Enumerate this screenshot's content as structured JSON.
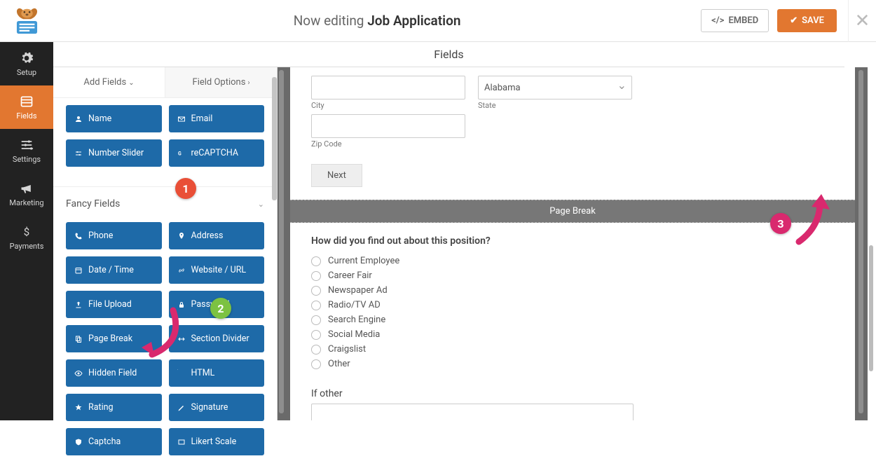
{
  "header": {
    "editing_prefix": "Now editing",
    "form_name": "Job Application",
    "embed": "EMBED",
    "save": "SAVE"
  },
  "leftnav": {
    "setup": "Setup",
    "fields": "Fields",
    "settings": "Settings",
    "marketing": "Marketing",
    "payments": "Payments"
  },
  "fields_header": "Fields",
  "sidetabs": {
    "add_fields": "Add Fields",
    "field_options": "Field Options"
  },
  "standard_fields": {
    "name": "Name",
    "email": "Email",
    "number_slider": "Number Slider",
    "recaptcha": "reCAPTCHA"
  },
  "fancy_section": "Fancy Fields",
  "fancy_fields": {
    "phone": "Phone",
    "address": "Address",
    "datetime": "Date / Time",
    "website": "Website / URL",
    "fileupload": "File Upload",
    "password": "Password",
    "pagebreak": "Page Break",
    "sectiondivider": "Section Divider",
    "hiddenfield": "Hidden Field",
    "html": "HTML",
    "rating": "Rating",
    "signature": "Signature",
    "captcha": "Captcha",
    "likert": "Likert Scale"
  },
  "preview": {
    "state_value": "Alabama",
    "city_label": "City",
    "state_label": "State",
    "zip_label": "Zip Code",
    "next": "Next",
    "pagebreak": "Page Break",
    "question": "How did you find out about this position?",
    "options": {
      "o1": "Current Employee",
      "o2": "Career Fair",
      "o3": "Newspaper Ad",
      "o4": "Radio/TV AD",
      "o5": "Search Engine",
      "o6": "Social Media",
      "o7": "Craigslist",
      "o8": "Other"
    },
    "if_other": "If other"
  },
  "annotations": {
    "b1": "1",
    "b2": "2",
    "b3": "3"
  }
}
